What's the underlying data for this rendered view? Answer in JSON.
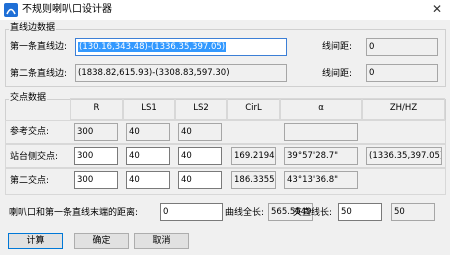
{
  "window": {
    "title": "不规则喇叭口设计器",
    "close": "✕"
  },
  "line_group": {
    "title": "直线边数据",
    "line1_label": "第一条直线边:",
    "line1_value": "(130.16,343.48)-(1336.35,397.05)",
    "line1_spacing_label": "线间距:",
    "line1_spacing_value": "0",
    "line2_label": "第二条直线边:",
    "line2_value": "(1838.82,615.93)-(3308.83,597.30)",
    "line2_spacing_label": "线间距:",
    "line2_spacing_value": "0"
  },
  "intersection_group": {
    "title": "交点数据",
    "headers": [
      "R",
      "LS1",
      "LS2",
      "CirL",
      "α",
      "ZH/HZ"
    ],
    "rows": [
      {
        "label": "参考交点:",
        "R": "300",
        "LS1": "40",
        "LS2": "40",
        "CirL": "",
        "alpha": "",
        "zhhz": ""
      },
      {
        "label": "站台侧交点:",
        "R": "300",
        "LS1": "40",
        "LS2": "40",
        "CirL": "169.2194",
        "alpha": "39°57'28.7\"",
        "zhhz": "(1336.35,397.05)"
      },
      {
        "label": "第二交点:",
        "R": "300",
        "LS1": "40",
        "LS2": "40",
        "CirL": "186.3355",
        "alpha": "43°13'36.8\"",
        "zhhz": ""
      }
    ]
  },
  "bottom": {
    "distance_label": "喇叭口和第一条直线末端的距离:",
    "distance_value": "0",
    "total_label": "曲线全长:",
    "total_value": "565.5549",
    "straight_label": "夹直线长:",
    "straight_value": "50",
    "straight_value2": "50"
  },
  "buttons": {
    "calc": "计算",
    "ok": "确定",
    "cancel": "取消"
  },
  "colors": {
    "selection": "#3399ff",
    "app_icon": "#1f6fd6",
    "focus_border": "#3c7fd6",
    "default_button": "#0078d7"
  }
}
